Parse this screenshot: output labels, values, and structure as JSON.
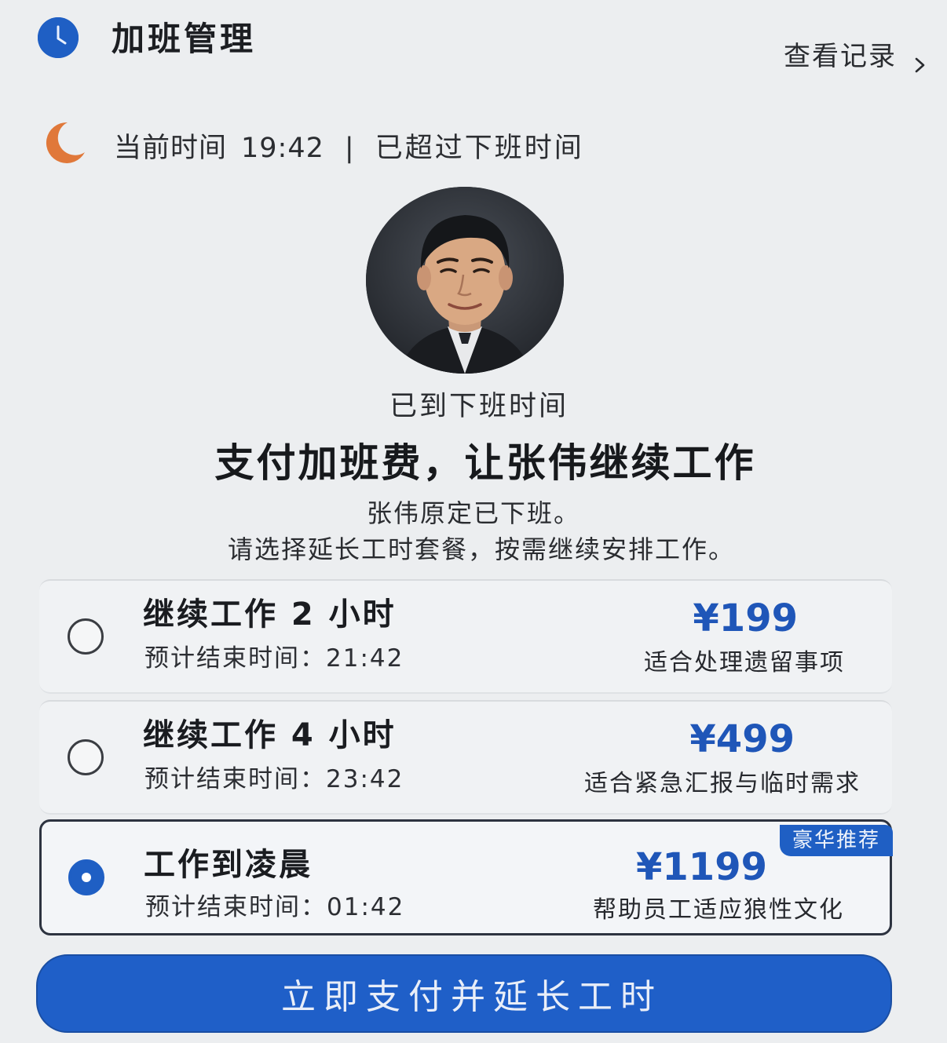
{
  "header": {
    "title": "加班管理",
    "records_link": "查看记录"
  },
  "status": {
    "label": "当前时间",
    "time": "19:42",
    "separator": "|",
    "message": "已超过下班时间"
  },
  "employee": {
    "reached_text": "已到下班时间",
    "headline": "支付加班费，让张伟继续工作",
    "desc_line1": "张伟原定已下班。",
    "desc_line2": "请选择延长工时套餐，按需继续安排工作。"
  },
  "plans": [
    {
      "name": "继续工作 2 小时",
      "end_time": "预计结束时间：21:42",
      "price": "¥199",
      "note": "适合处理遗留事项",
      "selected": false
    },
    {
      "name": "继续工作 4 小时",
      "end_time": "预计结束时间：23:42",
      "price": "¥499",
      "note": "适合紧急汇报与临时需求",
      "selected": false
    },
    {
      "name": "工作到凌晨",
      "end_time": "预计结束时间：01:42",
      "price": "¥1199",
      "note": "帮助员工适应狼性文化",
      "badge": "豪华推荐",
      "selected": true
    }
  ],
  "pay_button": {
    "label": "立即支付并延长工时"
  },
  "colors": {
    "accent": "#1f5fc4",
    "background": "#eceef0",
    "moon": "#e0783a"
  },
  "icons": [
    "clock-icon",
    "chevron-right-icon",
    "moon-icon",
    "radio-icon"
  ]
}
